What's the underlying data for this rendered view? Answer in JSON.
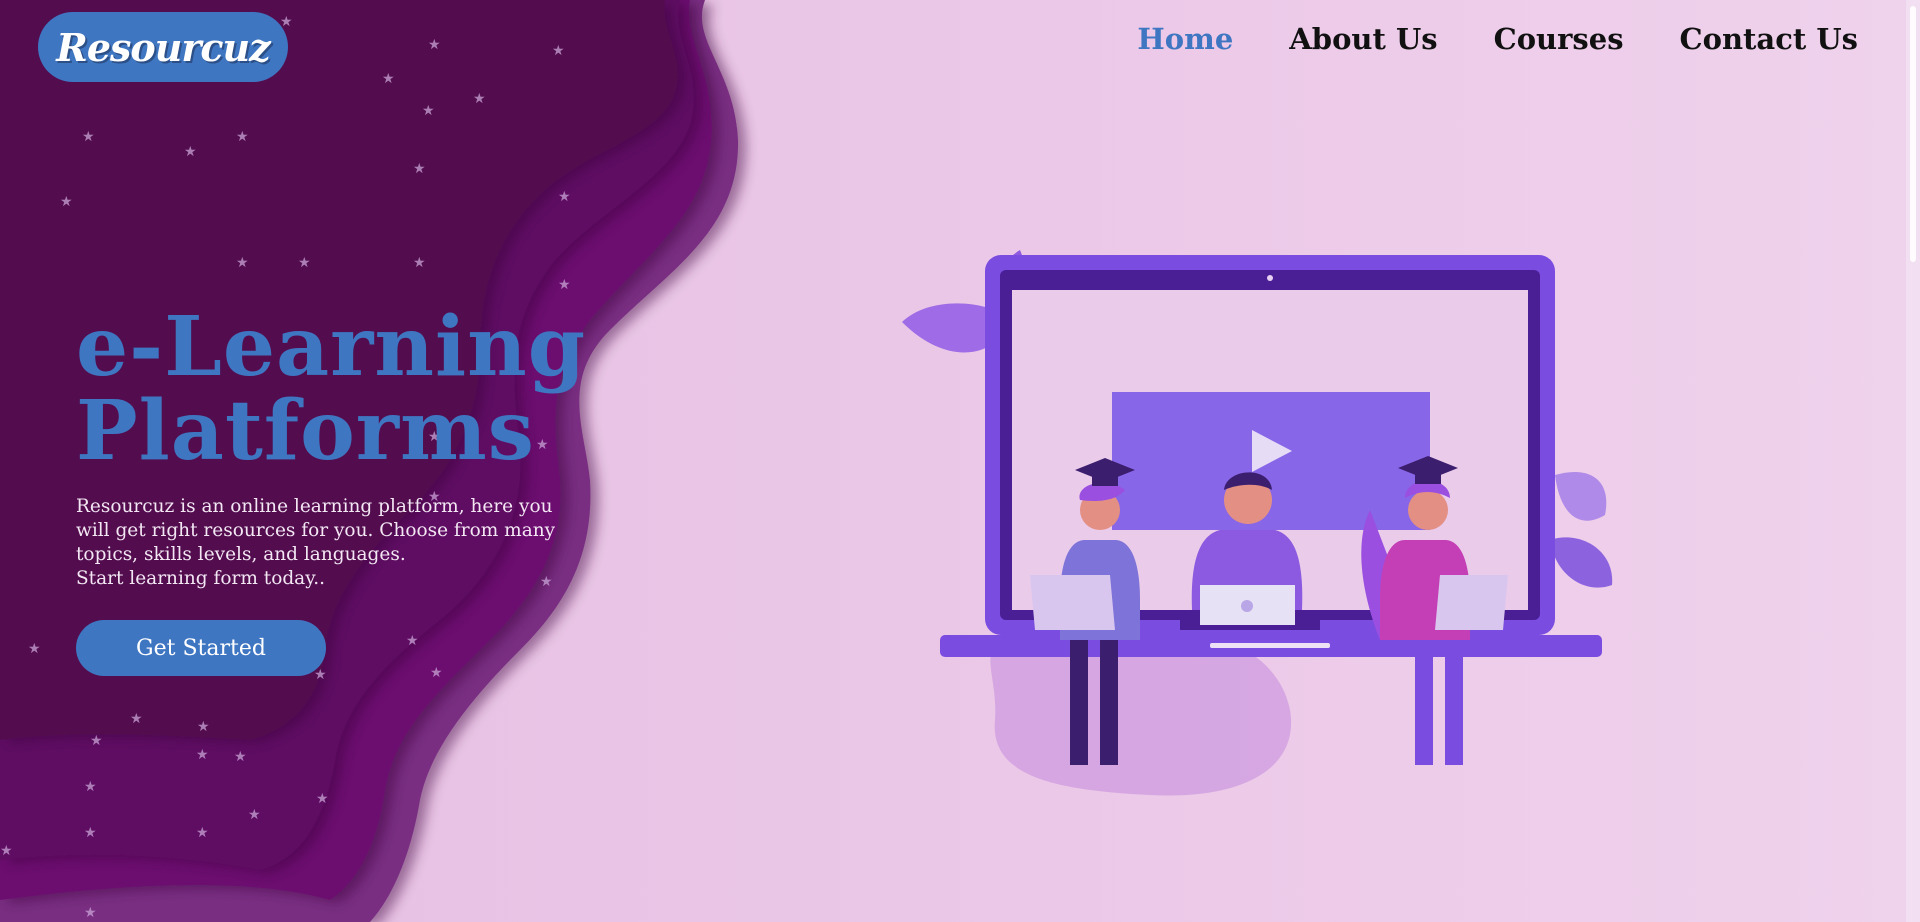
{
  "brand": {
    "logo_text": "Resourcuz"
  },
  "nav": {
    "items": [
      {
        "label": "Home",
        "active": true
      },
      {
        "label": "About Us",
        "active": false
      },
      {
        "label": "Courses",
        "active": false
      },
      {
        "label": "Contact Us",
        "active": false
      }
    ]
  },
  "hero": {
    "title_line1": "e-Learning",
    "title_line2": "Platforms",
    "description_lines": [
      "Resourcuz is an online learning platform, here you",
      "will get right resources for you. Choose from many",
      "topics, skills levels, and languages.",
      "Start learning form today.."
    ],
    "cta_label": "Get Started"
  },
  "colors": {
    "accent": "#3f76c2",
    "background": "#ecc9e8",
    "wave_dark": "#4e0d4e",
    "wave_mid": "#6a0e6e",
    "wave_light": "#7b2d82",
    "illustration_purple": "#7a4de0"
  },
  "icons": {
    "play": "play-icon",
    "star": "star-icon"
  }
}
